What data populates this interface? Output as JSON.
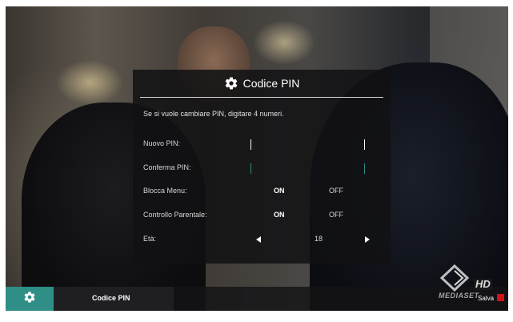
{
  "dialog": {
    "title": "Codice PIN",
    "icon": "gear-icon",
    "message": "Se si vuole cambiare PIN, digitare 4 numeri.",
    "rows": {
      "new_pin": {
        "label": "Nuovo PIN:"
      },
      "confirm_pin": {
        "label": "Conferma PIN:"
      },
      "block_menu": {
        "label": "Blocca Menu:",
        "on": "ON",
        "off": "OFF",
        "selected": "ON"
      },
      "parental": {
        "label": "Controllo Parentale:",
        "on": "ON",
        "off": "OFF",
        "selected": "ON"
      },
      "age": {
        "label": "Età:",
        "value": "18"
      }
    }
  },
  "bottom_bar": {
    "icon": "gear-icon",
    "title": "Codice PIN",
    "save_label": "Salva",
    "accent": "#2f8e86",
    "save_color": "#d2121a"
  },
  "logo": {
    "hd": "HD",
    "text": "MEDIASET"
  },
  "colors": {
    "dialog_bg": "#121214",
    "cursor_white": "#ffffff",
    "cursor_green": "#2f8e86"
  }
}
